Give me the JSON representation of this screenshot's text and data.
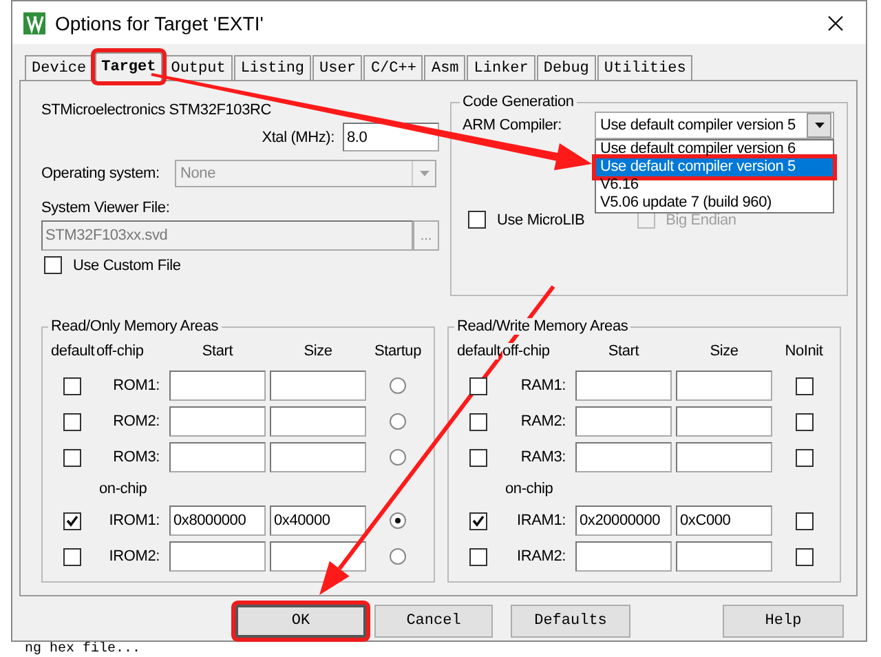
{
  "window": {
    "title": "Options for Target 'EXTI'"
  },
  "tabs": [
    {
      "label": "Device",
      "selected": false,
      "annotated": false
    },
    {
      "label": "Target",
      "selected": true,
      "annotated": true
    },
    {
      "label": "Output",
      "selected": false,
      "annotated": false
    },
    {
      "label": "Listing",
      "selected": false,
      "annotated": false
    },
    {
      "label": "User",
      "selected": false,
      "annotated": false
    },
    {
      "label": "C/C++",
      "selected": false,
      "annotated": false
    },
    {
      "label": "Asm",
      "selected": false,
      "annotated": false
    },
    {
      "label": "Linker",
      "selected": false,
      "annotated": false
    },
    {
      "label": "Debug",
      "selected": false,
      "annotated": false
    },
    {
      "label": "Utilities",
      "selected": false,
      "annotated": false
    }
  ],
  "target": {
    "device": "STMicroelectronics STM32F103RC",
    "xtal_label": "Xtal (MHz):",
    "xtal_value": "8.0",
    "os_label": "Operating system:",
    "os_value": "None",
    "os_disabled": true,
    "svf_label": "System Viewer File:",
    "svf_value": "STM32F103xx.svd",
    "browse_label": "...",
    "use_custom_file": {
      "label": "Use Custom File",
      "checked": false
    }
  },
  "code_generation": {
    "title": "Code Generation",
    "compiler_label": "ARM Compiler:",
    "compiler_value": "Use default compiler version 5",
    "expanded": true,
    "options": [
      {
        "label": "Use default compiler version 6",
        "selected": false,
        "annotated": false
      },
      {
        "label": "Use default compiler version 5",
        "selected": true,
        "annotated": true
      },
      {
        "label": "V6.16",
        "selected": false,
        "annotated": false
      },
      {
        "label": "V5.06 update 7 (build 960)",
        "selected": false,
        "annotated": false
      }
    ],
    "micro_lib": {
      "label": "Use MicroLIB",
      "checked": false,
      "disabled": false
    },
    "big_endian": {
      "label": "Big Endian",
      "checked": false,
      "disabled": true
    }
  },
  "rom_areas": {
    "title": "Read/Only Memory Areas",
    "columns": [
      "default",
      "off-chip",
      "Start",
      "Size",
      "Startup"
    ],
    "rows": [
      {
        "kind": "area",
        "default": false,
        "label": "ROM1:",
        "flag": false
      },
      {
        "kind": "area",
        "default": false,
        "label": "ROM2:",
        "flag": false
      },
      {
        "kind": "area",
        "default": false,
        "label": "ROM3:",
        "flag": false
      },
      {
        "kind": "heading",
        "label": "on-chip"
      },
      {
        "kind": "area",
        "default": true,
        "label": "IROM1:",
        "start": "0x8000000",
        "size": "0x40000",
        "flag": true
      },
      {
        "kind": "area",
        "default": false,
        "label": "IROM2:",
        "flag": false
      }
    ]
  },
  "ram_areas": {
    "title": "Read/Write Memory Areas",
    "columns": [
      "default",
      "off-chip",
      "Start",
      "Size",
      "NoInit"
    ],
    "rows": [
      {
        "kind": "area",
        "default": false,
        "label": "RAM1:",
        "flag": false
      },
      {
        "kind": "area",
        "default": false,
        "label": "RAM2:",
        "flag": false
      },
      {
        "kind": "area",
        "default": false,
        "label": "RAM3:",
        "flag": false
      },
      {
        "kind": "heading",
        "label": "on-chip"
      },
      {
        "kind": "area",
        "default": true,
        "label": "IRAM1:",
        "start": "0x20000000",
        "size": "0xC000",
        "flag": false
      },
      {
        "kind": "area",
        "default": false,
        "label": "IRAM2:",
        "flag": false
      }
    ]
  },
  "buttons": [
    {
      "label": "OK",
      "default": true,
      "annotated": true
    },
    {
      "label": "Cancel",
      "default": false,
      "annotated": false
    },
    {
      "label": "Defaults",
      "default": false,
      "annotated": false
    },
    {
      "label": "Help",
      "default": false,
      "annotated": false
    }
  ],
  "background_text": "ng hex file..."
}
